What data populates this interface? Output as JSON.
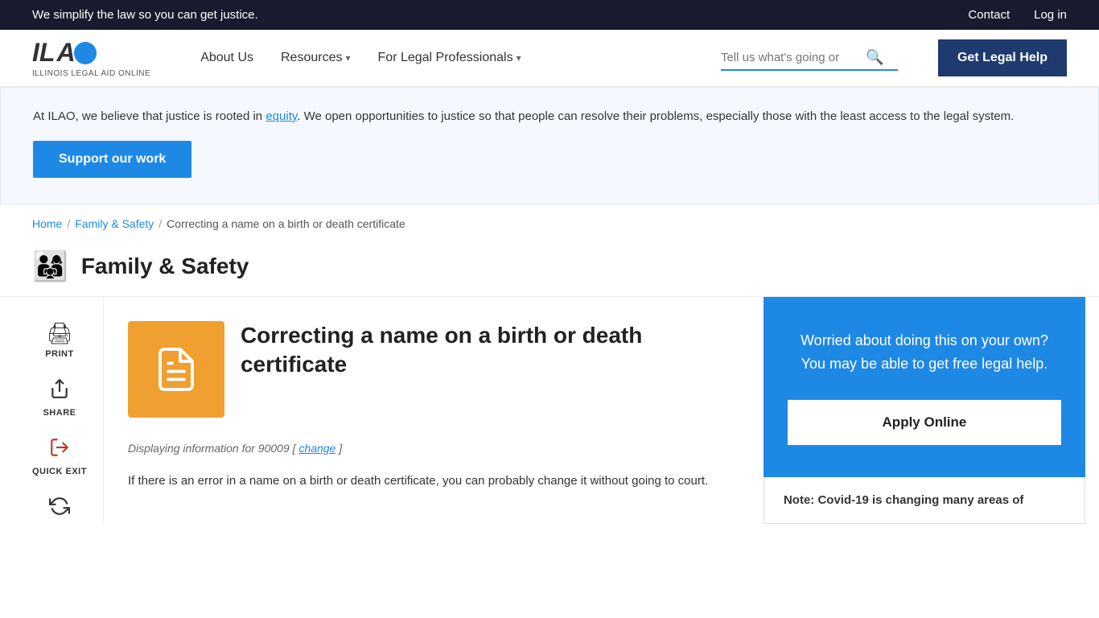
{
  "topBanner": {
    "tagline": "We simplify the law so you can get justice.",
    "links": [
      "Contact",
      "Log in"
    ]
  },
  "header": {
    "logoIL": "IL",
    "logoA": "A",
    "logoSubtitle": "ILLINOIS LEGAL AID ONLINE",
    "nav": [
      {
        "label": "About Us",
        "hasDropdown": false
      },
      {
        "label": "Resources",
        "hasDropdown": true
      },
      {
        "label": "For Legal Professionals",
        "hasDropdown": true
      }
    ],
    "searchPlaceholder": "Tell us what's going or",
    "getLegalHelpLabel": "Get Legal Help"
  },
  "infoBanner": {
    "text": "At ILAO, we believe that justice is rooted in equity. We open opportunities to justice so that people can resolve their problems, especially those with the least access to the legal system.",
    "equityLinkText": "equity",
    "supportBtnLabel": "Support our work"
  },
  "breadcrumb": {
    "items": [
      "Home",
      "Family & Safety",
      "Correcting a name on a birth or death certificate"
    ],
    "separator": "/"
  },
  "pageTitle": "Family & Safety",
  "sidebarActions": [
    {
      "label": "PRINT",
      "icon": "🖨"
    },
    {
      "label": "SHARE",
      "icon": "↑"
    },
    {
      "label": "QUICK EXIT",
      "icon": "📤"
    },
    {
      "label": "",
      "icon": "♻"
    }
  ],
  "article": {
    "title": "Correcting a name on a birth or death certificate",
    "thumbnailIcon": "📋",
    "locationText": "Displaying information for 90009 [",
    "locationLinkText": "change",
    "locationTextEnd": "]",
    "body": "If there is an error in a name on a birth or death certificate, you can probably change it without going to court."
  },
  "rightPanel": {
    "text": "Worried about doing this on your own? You may be able to get free legal help.",
    "applyBtnLabel": "Apply Online"
  },
  "notePanel": {
    "text": "Note: Covid-19 is changing many areas of"
  }
}
